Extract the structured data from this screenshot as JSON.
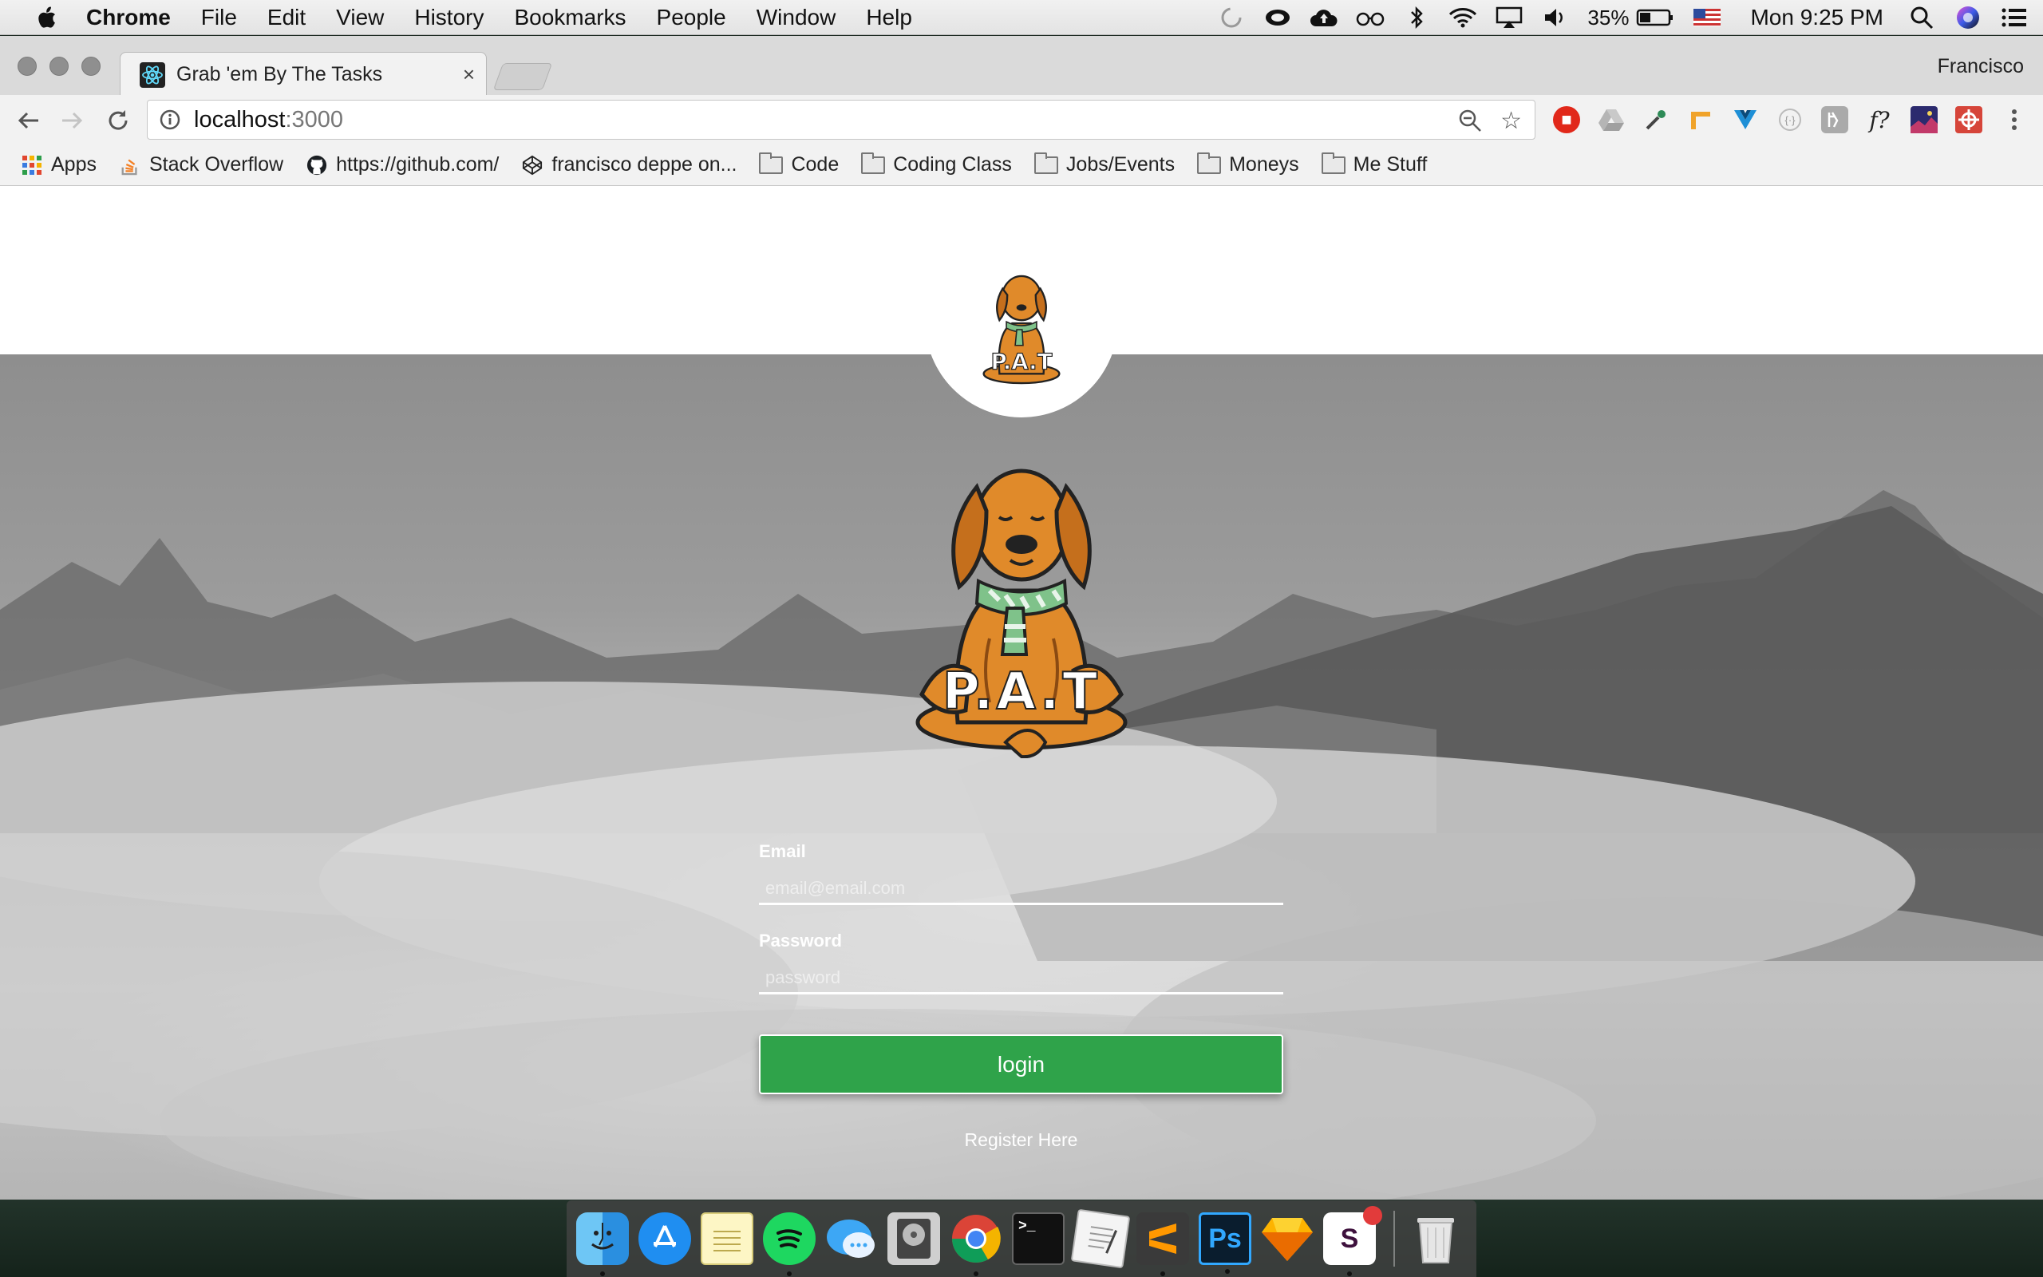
{
  "menubar": {
    "app_name": "Chrome",
    "menus": [
      "File",
      "Edit",
      "View",
      "History",
      "Bookmarks",
      "People",
      "Window",
      "Help"
    ],
    "battery": "35%",
    "clock": "Mon 9:25 PM"
  },
  "browser": {
    "tab_title": "Grab 'em By The Tasks",
    "tab_close": "×",
    "profile_name": "Francisco",
    "url_host": "localhost",
    "url_port": ":3000",
    "bookmarks": [
      "Apps",
      "Stack Overflow",
      "https://github.com/",
      "francisco deppe on...",
      "Code",
      "Coding Class",
      "Jobs/Events",
      "Moneys",
      "Me Stuff"
    ]
  },
  "logo": {
    "text": "P.A.T"
  },
  "login": {
    "email_label": "Email",
    "email_placeholder": "email@email.com",
    "password_label": "Password",
    "password_placeholder": "password",
    "login_button": "login",
    "register_link": "Register Here"
  },
  "dock": {
    "apps": [
      "finder",
      "app-store",
      "notes",
      "spotify",
      "messages",
      "disk-utility",
      "chrome",
      "terminal",
      "textedit",
      "sublime-text",
      "photoshop",
      "sketch",
      "slack",
      "trash"
    ],
    "photoshop_label": "Ps",
    "slack_label": "S",
    "terminal_label": ">_"
  },
  "colors": {
    "login_button": "#2fa34a",
    "dog_fur": "#e08a2a",
    "scarf": "#7fc28a"
  }
}
